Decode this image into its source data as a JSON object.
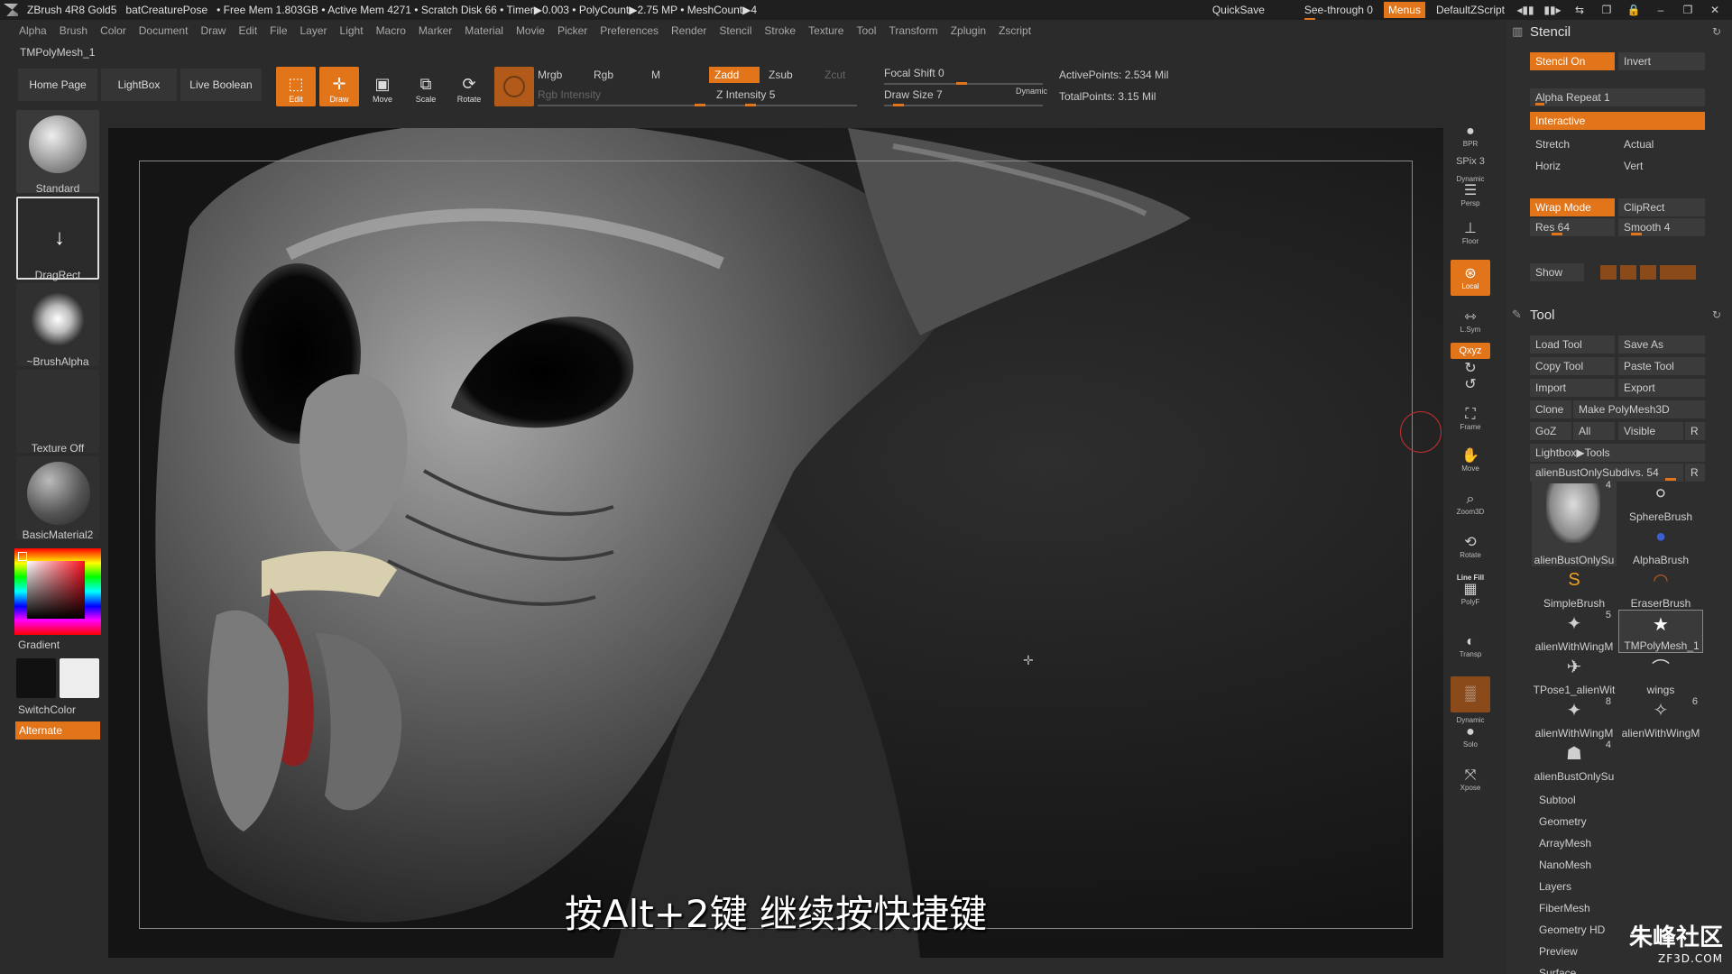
{
  "titlebar": {
    "app": "ZBrush 4R8 Gold5",
    "project": "batCreaturePose",
    "stats": "• Free Mem 1.803GB • Active Mem 4271 • Scratch Disk 66 • Timer▶0.003 • PolyCount▶2.75 MP • MeshCount▶4",
    "quicksave": "QuickSave",
    "see_through": "See-through  0",
    "menus": "Menus",
    "script": "DefaultZScript"
  },
  "menu": [
    "Alpha",
    "Brush",
    "Color",
    "Document",
    "Draw",
    "Edit",
    "File",
    "Layer",
    "Light",
    "Macro",
    "Marker",
    "Material",
    "Movie",
    "Picker",
    "Preferences",
    "Render",
    "Stencil",
    "Stroke",
    "Texture",
    "Tool",
    "Transform",
    "Zplugin",
    "Zscript"
  ],
  "tool_name": "TMPolyMesh_1",
  "shelf": {
    "home": "Home Page",
    "lightbox": "LightBox",
    "live_boolean": "Live Boolean",
    "edit": "Edit",
    "draw": "Draw",
    "move": "Move",
    "scale": "Scale",
    "rotate": "Rotate",
    "mrgb": "Mrgb",
    "rgb": "Rgb",
    "m": "M",
    "rgb_intensity": "Rgb Intensity",
    "zadd": "Zadd",
    "zsub": "Zsub",
    "zcut": "Zcut",
    "z_intensity": "Z Intensity 5",
    "focal_shift": "Focal Shift 0",
    "draw_size": "Draw Size 7",
    "dynamic": "Dynamic",
    "active_points": "ActivePoints: 2.534 Mil",
    "total_points": "TotalPoints: 3.15 Mil"
  },
  "left": {
    "brush": "Standard",
    "stroke": "DragRect",
    "alpha": "~BrushAlpha",
    "texture": "Texture Off",
    "material": "BasicMaterial2",
    "gradient": "Gradient",
    "switch_color": "SwitchColor",
    "alternate": "Alternate"
  },
  "viewport": {
    "subtitle": "按Alt+2键 继续按快捷键"
  },
  "dock": {
    "bpr": "BPR",
    "spix": "SPix 3",
    "persp": "Persp",
    "dynamic": "Dynamic",
    "floor": "Floor",
    "local": "Local",
    "lsym": "L.Sym",
    "xyz": "Qxyz",
    "frame": "Frame",
    "move": "Move",
    "zoom3d": "Zoom3D",
    "rotate": "Rotate",
    "linefill": "Line Fill",
    "polyf": "PolyF",
    "transp": "Transp",
    "dynamic2": "Dynamic",
    "solo": "Solo",
    "xpose": "Xpose"
  },
  "stencil": {
    "title": "Stencil",
    "stencil_on": "Stencil On",
    "invert": "Invert",
    "alpha_repeat": "Alpha Repeat 1",
    "interactive": "Interactive",
    "stretch": "Stretch",
    "actual": "Actual",
    "horiz": "Horiz",
    "vert": "Vert",
    "wrap_mode": "Wrap Mode",
    "cliprect": "ClipRect",
    "res": "Res 64",
    "smooth": "Smooth 4",
    "show": "Show"
  },
  "tool": {
    "title": "Tool",
    "load": "Load Tool",
    "save_as": "Save As",
    "copy": "Copy Tool",
    "paste": "Paste Tool",
    "import": "Import",
    "export": "Export",
    "clone": "Clone",
    "make_polymesh": "Make PolyMesh3D",
    "goz": "GoZ",
    "all": "All",
    "visible": "Visible",
    "r": "R",
    "lightbox_tools": "Lightbox▶Tools",
    "subdiv": "alienBustOnlySubdivs. 54",
    "grid": [
      {
        "name": "alienBustOnlySu",
        "count": "4"
      },
      {
        "name": "SphereBrush",
        "count": ""
      },
      {
        "name": "AlphaBrush",
        "count": ""
      },
      {
        "name": "SimpleBrush",
        "count": ""
      },
      {
        "name": "EraserBrush",
        "count": ""
      },
      {
        "name": "alienWithWingM",
        "count": "5"
      },
      {
        "name": "TMPolyMesh_1",
        "count": ""
      },
      {
        "name": "TPose1_alienWit",
        "count": ""
      },
      {
        "name": "wings",
        "count": ""
      },
      {
        "name": "alienWithWingM",
        "count": "8"
      },
      {
        "name": "alienWithWingM",
        "count": "6"
      },
      {
        "name": "alienBustOnlySu",
        "count": "4"
      }
    ],
    "sub_menus": [
      "Subtool",
      "Geometry",
      "ArrayMesh",
      "NanoMesh",
      "Layers",
      "FiberMesh",
      "Geometry HD",
      "Preview",
      "Surface"
    ]
  },
  "watermark": {
    "brand": "朱峰社区",
    "site": "ZF3D.COM"
  },
  "colors": {
    "accent": "#e2741a",
    "panel": "#2e2e2e",
    "background": "#2b2b2b"
  }
}
